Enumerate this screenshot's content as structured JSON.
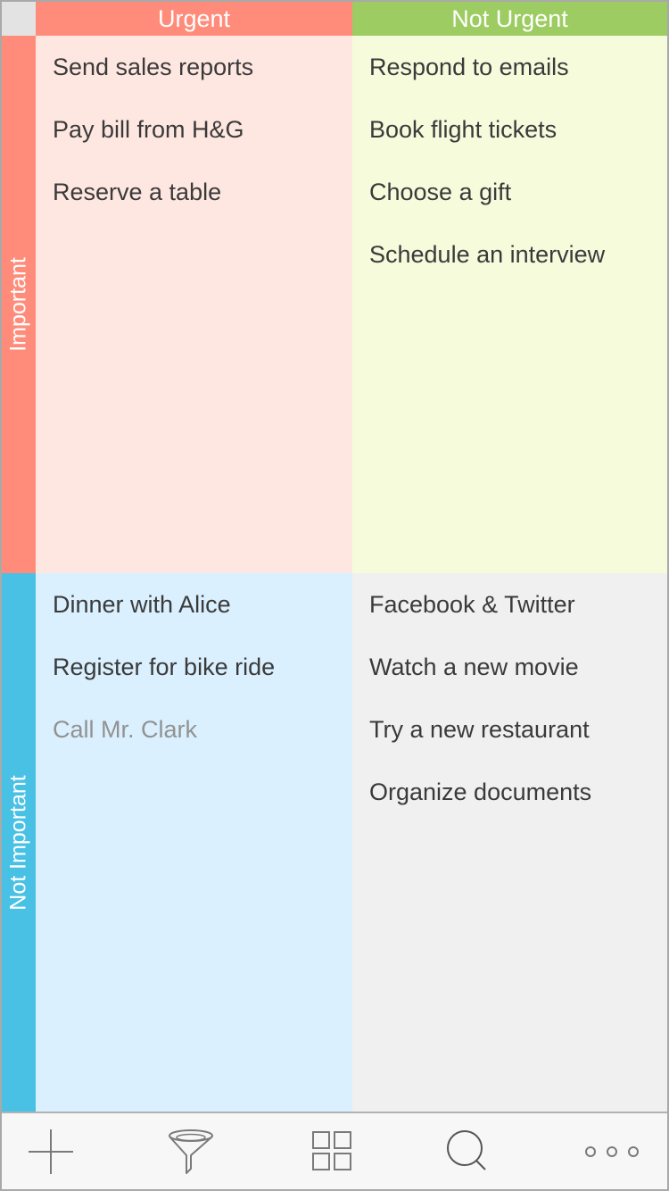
{
  "matrix": {
    "columns": [
      {
        "label": "Urgent",
        "color": "#ff8c7b"
      },
      {
        "label": "Not Urgent",
        "color": "#9dcc62"
      }
    ],
    "rows": [
      {
        "label": "Important",
        "color": "#ff8c7b"
      },
      {
        "label": "Not Important",
        "color": "#48c1e5"
      }
    ],
    "quadrants": {
      "urgent_important": {
        "tasks": [
          {
            "title": "Send sales reports",
            "completed": false
          },
          {
            "title": "Pay bill from H&G",
            "completed": false
          },
          {
            "title": "Reserve a table",
            "completed": false
          }
        ]
      },
      "not_urgent_important": {
        "tasks": [
          {
            "title": "Respond to emails",
            "completed": false
          },
          {
            "title": "Book flight tickets",
            "completed": false
          },
          {
            "title": "Choose a gift",
            "completed": false
          },
          {
            "title": "Schedule an interview",
            "completed": false
          }
        ]
      },
      "urgent_not_important": {
        "tasks": [
          {
            "title": "Dinner with Alice",
            "completed": false
          },
          {
            "title": "Register for bike ride",
            "completed": false
          },
          {
            "title": "Call Mr. Clark",
            "completed": true
          }
        ]
      },
      "not_urgent_not_important": {
        "tasks": [
          {
            "title": "Facebook & Twitter",
            "completed": false
          },
          {
            "title": "Watch a new movie",
            "completed": false
          },
          {
            "title": "Try a new restaurant",
            "completed": false
          },
          {
            "title": "Organize documents",
            "completed": false
          }
        ]
      }
    }
  },
  "toolbar": {
    "items": [
      {
        "icon": "plus-icon",
        "action": "add"
      },
      {
        "icon": "filter-icon",
        "action": "filter"
      },
      {
        "icon": "grid-icon",
        "action": "view"
      },
      {
        "icon": "search-icon",
        "action": "search"
      },
      {
        "icon": "more-icon",
        "action": "more"
      }
    ]
  }
}
